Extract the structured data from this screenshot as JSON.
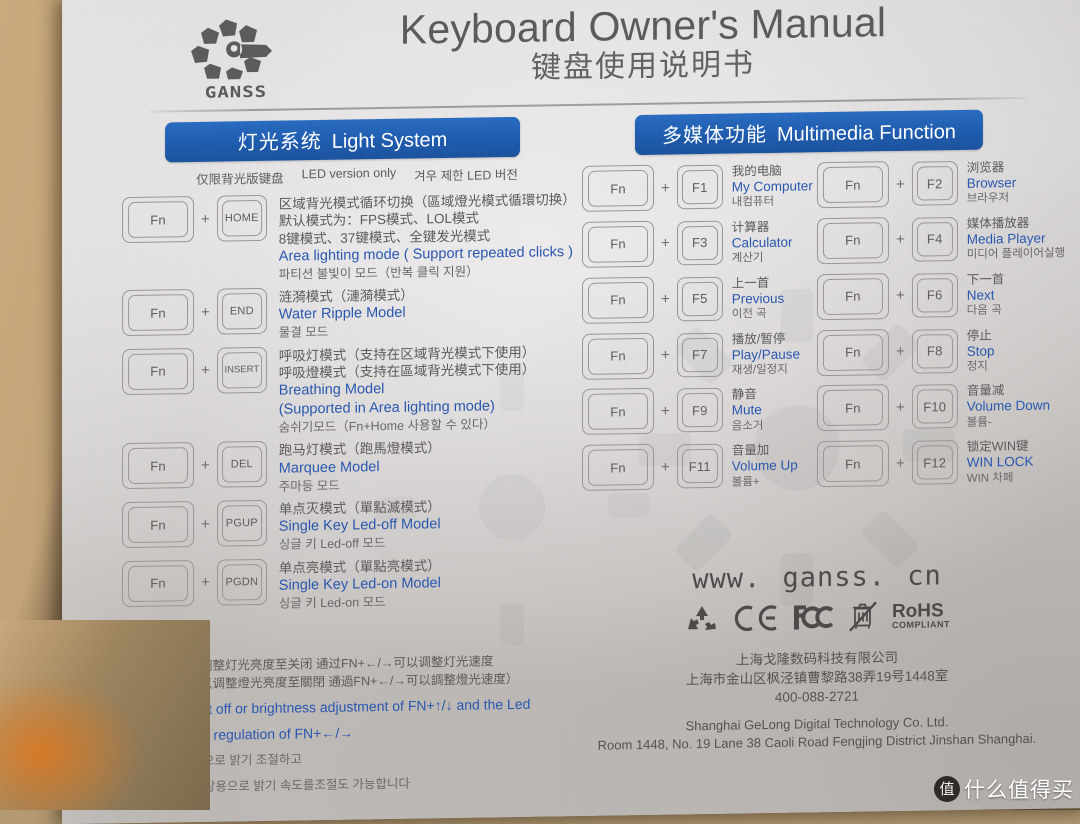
{
  "header": {
    "brand": "GANSS",
    "title_en": "Keyboard Owner's Manual",
    "title_cn": "键盘使用说明书"
  },
  "light_system": {
    "pill_cn": "灯光系统",
    "pill_en": "Light System",
    "note_cn": "仅限背光版键盘",
    "note_en": "LED version only",
    "note_kr": "겨우 제한 LED 버전",
    "rows": [
      {
        "key1": "Fn",
        "plus": "+",
        "key2": "HOME",
        "cn": [
          "区域背光模式循环切换（區域燈光模式循環切换）",
          "默认模式为：FPS模式、LOL模式",
          "8键模式、37键模式、全键发光模式"
        ],
        "en": [
          "Area lighting mode ( Support repeated clicks )"
        ],
        "kr": [
          "파티션 불빛이 모드（반복 클릭 지원）"
        ]
      },
      {
        "key1": "Fn",
        "plus": "+",
        "key2": "END",
        "cn": [
          "涟漪模式（漣漪模式）"
        ],
        "en": [
          "Water Ripple Model"
        ],
        "kr": [
          "물결 모드"
        ]
      },
      {
        "key1": "Fn",
        "plus": "+",
        "key2": "INSERT",
        "cn": [
          "呼吸灯模式（支持在区域背光模式下使用）",
          "呼吸燈模式（支持在區域背光模式下使用）"
        ],
        "en": [
          "Breathing Model",
          "(Supported in Area lighting mode)"
        ],
        "kr": [
          "숨쉬기모드（Fn+Home 사용할 수 있다）"
        ]
      },
      {
        "key1": "Fn",
        "plus": "+",
        "key2": "DEL",
        "cn": [
          "跑马灯模式（跑馬燈模式）"
        ],
        "en": [
          "Marquee Model"
        ],
        "kr": [
          "주마등 모드"
        ]
      },
      {
        "key1": "Fn",
        "plus": "+",
        "key2": "PGUP",
        "cn": [
          "单点灭模式（單點滅模式）"
        ],
        "en": [
          "Single Key Led-off Model"
        ],
        "kr": [
          "싱글 키 Led-off 모드"
        ]
      },
      {
        "key1": "Fn",
        "plus": "+",
        "key2": "PGDN",
        "cn": [
          "单点亮模式（單點亮模式）"
        ],
        "en": [
          "Single Key Led-on Model"
        ],
        "kr": [
          "싱글 키 Led-on 모드"
        ]
      }
    ]
  },
  "multimedia": {
    "pill_cn": "多媒体功能",
    "pill_en": "Multimedia Function",
    "rows": [
      {
        "key1": "Fn",
        "plus": "+",
        "key2": "F1",
        "cn": "我的电脑",
        "en": "My Computer",
        "kr": "내컴퓨터"
      },
      {
        "key1": "Fn",
        "plus": "+",
        "key2": "F2",
        "cn": "浏览器",
        "en": "Browser",
        "kr": "브라우저"
      },
      {
        "key1": "Fn",
        "plus": "+",
        "key2": "F3",
        "cn": "计算器",
        "en": "Calculator",
        "kr": "계산기"
      },
      {
        "key1": "Fn",
        "plus": "+",
        "key2": "F4",
        "cn": "媒体播放器",
        "en": "Media Player",
        "kr": "미디어 플레이어실행"
      },
      {
        "key1": "Fn",
        "plus": "+",
        "key2": "F5",
        "cn": "上一首",
        "en": "Previous",
        "kr": "이전 곡"
      },
      {
        "key1": "Fn",
        "plus": "+",
        "key2": "F6",
        "cn": "下一首",
        "en": "Next",
        "kr": "다음 곡"
      },
      {
        "key1": "Fn",
        "plus": "+",
        "key2": "F7",
        "cn": "播放/暂停",
        "en": "Play/Pause",
        "kr": "재생/일정지"
      },
      {
        "key1": "Fn",
        "plus": "+",
        "key2": "F8",
        "cn": "停止",
        "en": "Stop",
        "kr": "정지"
      },
      {
        "key1": "Fn",
        "plus": "+",
        "key2": "F9",
        "cn": "静音",
        "en": "Mute",
        "kr": "음소거"
      },
      {
        "key1": "Fn",
        "plus": "+",
        "key2": "F10",
        "cn": "音量减",
        "en": "Volume Down",
        "kr": "볼륨-"
      },
      {
        "key1": "Fn",
        "plus": "+",
        "key2": "F11",
        "cn": "音量加",
        "en": "Volume Up",
        "kr": "볼륨+"
      },
      {
        "key1": "Fn",
        "plus": "+",
        "key2": "F12",
        "cn": "锁定WIN键",
        "en": "WIN LOCK",
        "kr": "WIN 차페"
      }
    ]
  },
  "footer_left": {
    "cn1": "通過FN+↑/↓可以调整灯光亮度至关闭  通过FN+←/→可以调整灯光速度",
    "cn2": "（通過FN+↑/↓可以调整燈光亮度至關閉 通過FN+←/→可以調整燈光速度）",
    "en1": "Support the light off or brightness adjustment of FN+↑/↓ and the Led",
    "en2": "response speed regulation of FN+←/→",
    "kr1": "FN+↑/↓ 버튼 사용으로 밝기 조절하고",
    "kr2": "FN+←/→ 버튼을 상용으로 밝기 속도를조절도 가능합니다"
  },
  "footer_right": {
    "website": "www. ganss. cn",
    "certs": [
      "recycle-icon",
      "ce-icon",
      "fcc-icon",
      "weee-bin-icon",
      "rohs-icon"
    ],
    "rohs_main": "RoHS",
    "rohs_sub": "COMPLIANT",
    "company_cn": "上海戈隆数码科技有限公司",
    "address_cn": "上海市金山区枫泾镇曹黎路38弄19号1448室",
    "tel": "400-088-2721",
    "company_en": "Shanghai GeLong Digital Technology Co. Ltd.",
    "address_en": "Room 1448, No. 19 Lane 38 Caoli Road Fengjing District Jinshan Shanghai."
  },
  "watermark": {
    "badge": "值",
    "text": "什么值得买"
  },
  "colors": {
    "accent_blue": "#2a58b0",
    "pill_blue": "#1f5cae",
    "paper": "#e3e1e1",
    "ink_gray": "#5d5b59"
  }
}
